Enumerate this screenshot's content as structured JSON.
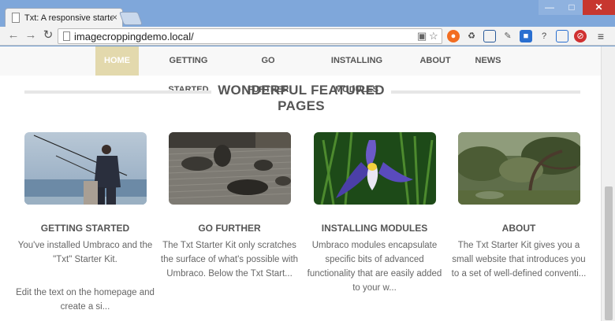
{
  "browser": {
    "tab_title": "Txt: A responsive starter kit",
    "tab_close": "×",
    "url": "imagecroppingdemo.local/",
    "window_buttons": {
      "minimize": "—",
      "maximize": "□",
      "close": "✕"
    },
    "nav_icons": {
      "back": "back-arrow-icon",
      "forward": "forward-arrow-icon",
      "reload": "reload-icon"
    }
  },
  "nav": {
    "items": [
      {
        "label": "HOME",
        "active": true
      },
      {
        "label": "GETTING STARTED"
      },
      {
        "label": "GO FURTHER"
      },
      {
        "label": "INSTALLING MODULES"
      },
      {
        "label": "ABOUT"
      },
      {
        "label": "NEWS"
      }
    ]
  },
  "featured": {
    "title": "WONDERFUL FEATURED PAGES",
    "cards": [
      {
        "title": "GETTING STARTED",
        "image": "fisherman-photo",
        "text": [
          "You've installed Umbraco and the \"Txt\" Starter Kit.",
          "Edit the text on the homepage and create a si..."
        ]
      },
      {
        "title": "GO FURTHER",
        "image": "zen-garden-photo",
        "text": [
          "The Txt Starter Kit only scratches the surface of what's possible with Umbraco. Below the Txt Start..."
        ]
      },
      {
        "title": "INSTALLING MODULES",
        "image": "iris-flower-photo",
        "text": [
          "Umbraco modules encapsulate specific bits of advanced functionality that are easily added to your w..."
        ]
      },
      {
        "title": "ABOUT",
        "image": "japanese-garden-photo",
        "text": [
          "The Txt Starter Kit gives you a small website that introduces you to a set of well-defined conventi..."
        ]
      }
    ]
  },
  "colors": {
    "nav_active": "#e3d9ad",
    "heading": "#555555",
    "body_text": "#666666"
  }
}
